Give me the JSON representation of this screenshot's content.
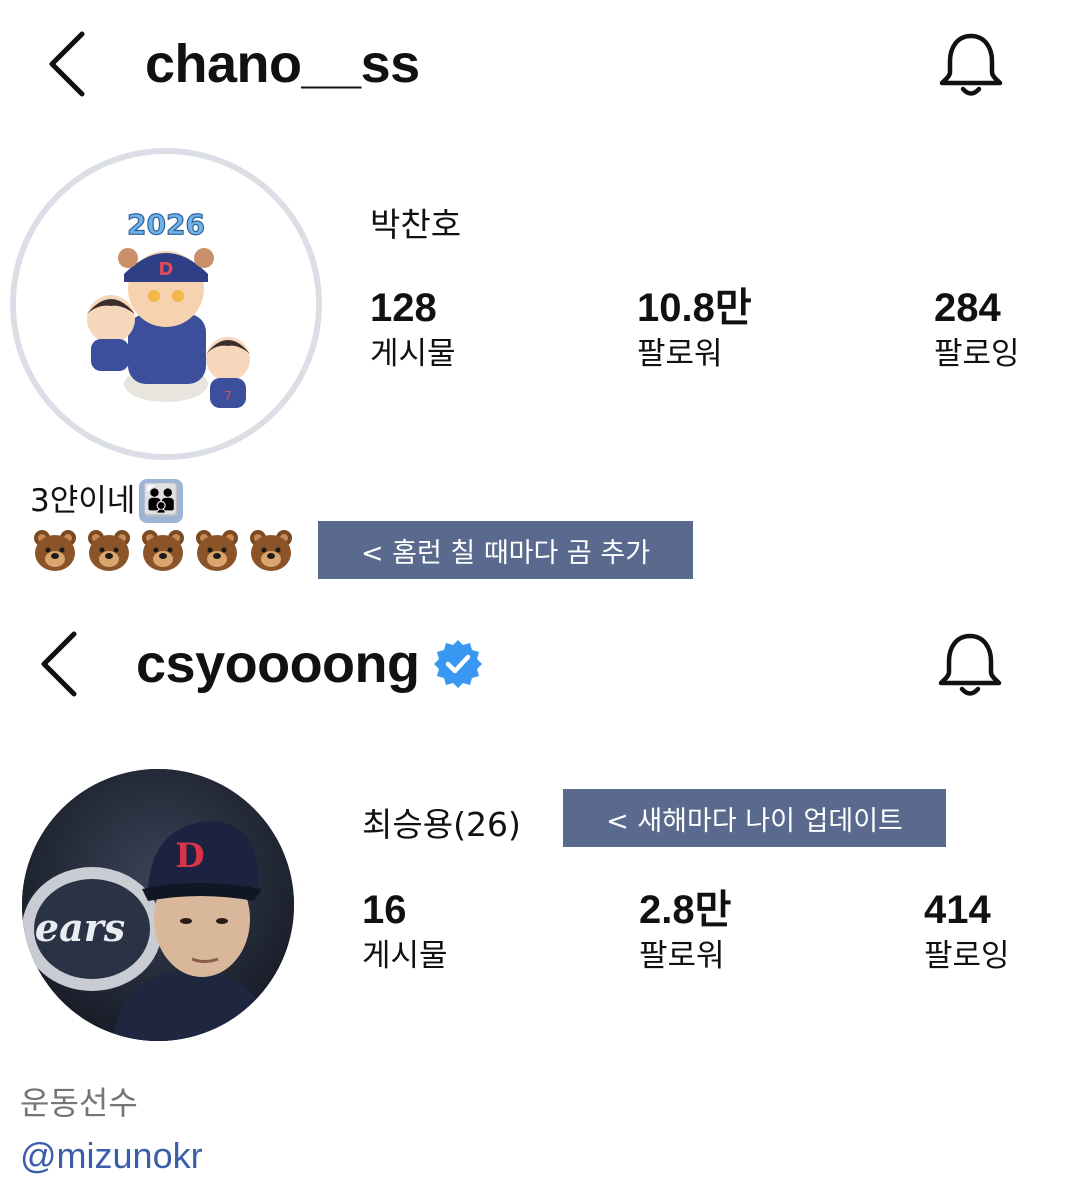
{
  "profile1": {
    "username": "chano__ss",
    "display_name": "박찬호",
    "stats": [
      {
        "count": "128",
        "label": "게시물"
      },
      {
        "count": "10.8만",
        "label": "팔로워"
      },
      {
        "count": "284",
        "label": "팔로잉"
      }
    ],
    "avatar_badge": "2026",
    "bio_line": "3얀이네",
    "bio_emoji": "👪",
    "bear_emojis": [
      "🐻",
      "🐻",
      "🐻",
      "🐻",
      "🐻"
    ],
    "annotation": "< 홈런 칠 때마다 곰 추가"
  },
  "profile2": {
    "username": "csyoooong",
    "verified": true,
    "display_name": "최승용(26)",
    "annotation": "< 새해마다 나이 업데이트",
    "stats": [
      {
        "count": "16",
        "label": "게시물"
      },
      {
        "count": "2.8만",
        "label": "팔로워"
      },
      {
        "count": "414",
        "label": "팔로잉"
      }
    ],
    "category": "운동선수",
    "link": "@mizunokr"
  },
  "icons": {
    "back": "chevron-left-icon",
    "bell": "bell-icon",
    "verified": "verified-badge-icon",
    "bear": "bear-face-icon"
  },
  "colors": {
    "annotation_bg": "#5a6a8e",
    "verified_blue": "#3897f0",
    "link_blue": "#3b5ea8",
    "avatar_ring": "#dbdee4"
  }
}
